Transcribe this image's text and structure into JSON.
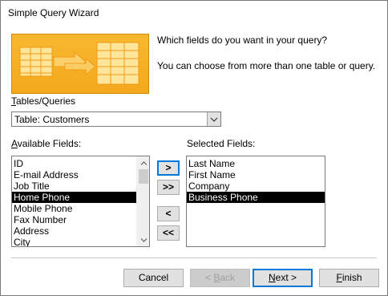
{
  "window": {
    "title": "Simple Query Wizard"
  },
  "intro": {
    "question": "Which fields do you want in your query?",
    "hint": "You can choose from more than one table or query."
  },
  "tables_queries": {
    "label_mnemonic": "T",
    "label_rest": "ables/Queries",
    "selected": "Table: Customers",
    "dropdown_icon": "chevron-down-icon"
  },
  "available_fields": {
    "label_mnemonic": "A",
    "label_rest": "vailable Fields:",
    "items": [
      "ID",
      "E-mail Address",
      "Job Title",
      "Home Phone",
      "Mobile Phone",
      "Fax Number",
      "Address",
      "City"
    ],
    "selected_index": 3
  },
  "selected_fields": {
    "label": "Selected Fields:",
    "items": [
      "Last Name",
      "First Name",
      "Company",
      "Business Phone"
    ],
    "selected_index": 3
  },
  "move_buttons": {
    "add_one": ">",
    "add_all": ">>",
    "remove_one": "<",
    "remove_all": "<<"
  },
  "buttons": {
    "cancel": "Cancel",
    "back_mnemonic": "B",
    "back_prefix": "< ",
    "back_rest": "ack",
    "next_mnemonic": "N",
    "next_rest": "ext >",
    "finish_mnemonic": "F",
    "finish_rest": "inish"
  },
  "colors": {
    "accent": "#0078d7",
    "selection": "#000000",
    "illustration": "#f4a81c"
  }
}
